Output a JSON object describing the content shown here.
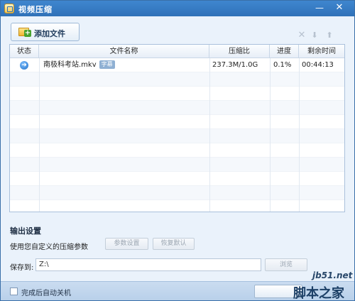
{
  "window": {
    "title": "视频压缩",
    "minimize": "—",
    "close": "✕"
  },
  "toolbar": {
    "add_label": "添加文件",
    "icons": [
      "delete-icon",
      "move-down-icon",
      "move-up-icon"
    ],
    "delete_glyph": "✕",
    "down_glyph": "⬇",
    "up_glyph": "⬆"
  },
  "table": {
    "headers": {
      "status": "状态",
      "name": "文件名称",
      "ratio": "压缩比",
      "progress": "进度",
      "remaining": "剩余时间"
    },
    "rows": [
      {
        "status_icon": "play-arrow-icon",
        "status_glyph": "➜",
        "name": "南极科考站.mkv",
        "tag": "字幕",
        "ratio": "237.3M/1.0G",
        "progress": "0.1%",
        "remaining": "00:44:13"
      }
    ]
  },
  "output": {
    "title": "输出设置",
    "description": "使用您自定义的压缩参数",
    "param_button": "参数设置",
    "reset_button": "恢复默认",
    "save_label": "保存到:",
    "save_path": "Z:\\",
    "browse_button": "浏览"
  },
  "footer": {
    "shutdown_label": "完成后自动关机",
    "shutdown_checked": false,
    "start_button": ""
  },
  "watermark": {
    "site": "jb51.net",
    "text": "脚本之家"
  },
  "colors": {
    "title_bar": "#3579c0",
    "background": "#eaf2fb",
    "accent_icon": "#1f6fc7"
  }
}
